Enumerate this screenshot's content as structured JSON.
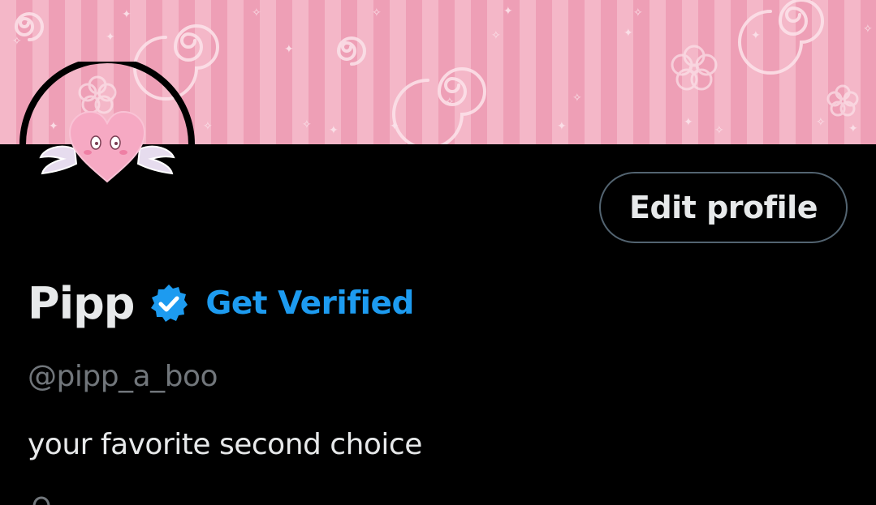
{
  "profile": {
    "display_name": "Pipp",
    "verified": true,
    "get_verified_label": "Get Verified",
    "handle": "@pipp_a_boo",
    "bio": "your favorite second choice",
    "edit_profile_label": "Edit profile"
  },
  "banner": {
    "pattern": "pink-stripes-swirls-stars",
    "stripe_light": "#f4b7c8",
    "stripe_dark": "#ee9fb6"
  },
  "avatar": {
    "icon": "winged-heart-icon",
    "ring_color": "#000000"
  },
  "colors": {
    "background": "#000000",
    "primary_text": "#e7e9ea",
    "secondary_text": "#71767b",
    "accent": "#1d9bf0",
    "button_border": "#536471"
  }
}
